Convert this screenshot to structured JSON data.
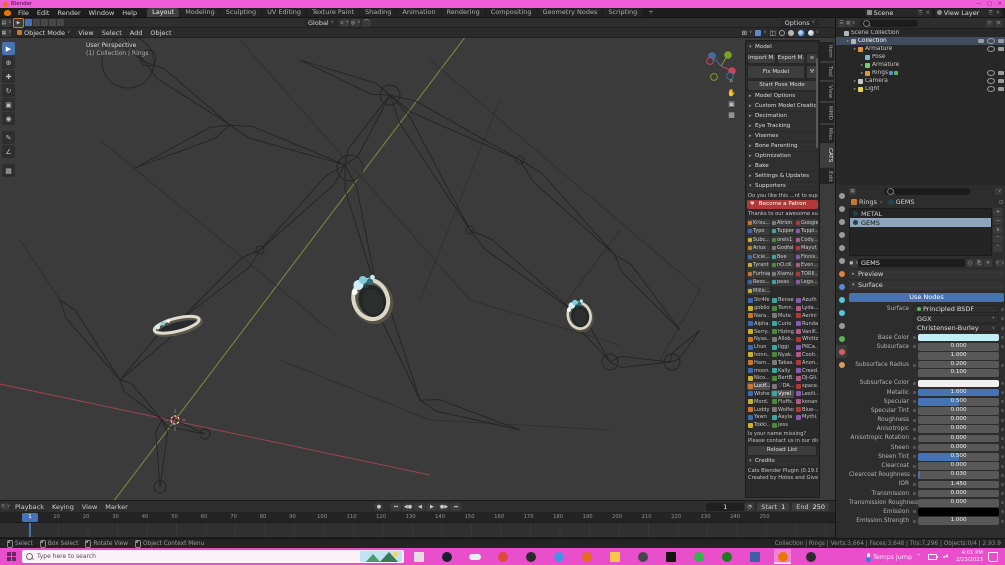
{
  "colors": {
    "accent": "#4772b3",
    "titlebar_pink": "#ef5ed8",
    "taskbar_pink": "#e94ecb",
    "patron_red": "#b03a3a",
    "base_color": "#c3ecf7",
    "subsurface_color": "#f0f0f0",
    "emission_color": "#000000"
  },
  "window": {
    "title": "Blender"
  },
  "topbar": {
    "menus": [
      "File",
      "Edit",
      "Render",
      "Window",
      "Help"
    ],
    "workspaces": [
      "Layout",
      "Modeling",
      "Sculpting",
      "UV Editing",
      "Texture Paint",
      "Shading",
      "Animation",
      "Rendering",
      "Compositing",
      "Geometry Nodes",
      "Scripting"
    ],
    "active_workspace": "Layout",
    "add_workspace": "+",
    "scene_name": "Scene",
    "view_layer_name": "View Layer"
  },
  "tool_row": {
    "orientation": "Global",
    "options": "Options"
  },
  "viewport": {
    "mode": "Object Mode",
    "menus": [
      "View",
      "Select",
      "Add",
      "Object"
    ],
    "overlay_line1": "User Perspective",
    "overlay_line2": "(1) Collection | Rings",
    "tools": [
      "select-box",
      "cursor",
      "move",
      "rotate",
      "scale",
      "transform",
      "annotate",
      "measure",
      "add-cube"
    ]
  },
  "n_panel": {
    "tabs": [
      "Item",
      "Tool",
      "View",
      "MMD",
      "Misc",
      "CATS",
      "Edit"
    ],
    "active_tab": "CATS",
    "model": {
      "title": "Model",
      "import_label": "Import M...",
      "export_label": "Export M...",
      "fix_model": "Fix Model",
      "start_pose": "Start Pose Mode"
    },
    "sections": [
      "Model Options",
      "Custom Model Creation",
      "Decimation",
      "Eye Tracking",
      "Visemes",
      "Bone Parenting",
      "Optimization",
      "Bake",
      "Settings & Updates"
    ],
    "supporters_title": "Supporters",
    "supporters": {
      "question": "Do you like this ...nt to support us?",
      "patron": "Become a Patron",
      "thanks": "Thanks to our awesome supporte...",
      "badges": [
        "Krisu...",
        "Atrion",
        "Googie",
        "Typo",
        "Tupper",
        "Tuppi...",
        "Subc...",
        "orels1",
        "Cody...",
        "Arius",
        "Godfal",
        "Mayuf...",
        "Cicie...",
        "Bee",
        "Finnis...",
        "Tyrant",
        "nO.cK",
        "Even...",
        "Furtnap",
        "Xiamu",
        "TORII...",
        "Reos...",
        "peas",
        "Lego...",
        "Millic..."
      ],
      "names": [
        "Str4fe",
        "Bense...",
        "Azuth",
        "gobliox",
        "Tomn.",
        "Lyda...",
        "Nara...",
        "Mute.",
        "Aerini",
        "Alpha...",
        "Curio",
        "Runda",
        "Serry...",
        "Hizing",
        "Vanill...",
        "Nyas...",
        "Allob...",
        "Whittz",
        "Lhun",
        "Iiggi",
        "PKCa...",
        "honn...",
        "Nyak...",
        "Coolr...",
        "Ham...",
        "Tabas...",
        "Anon...",
        "moon.",
        "Kally",
        "Creed...",
        "Nico...",
        "BertB...",
        "DJ-Gli...",
        "Lucif...",
        "♡DA...",
        "space...",
        "Wishes",
        "Vyrel",
        "Lexiii...",
        "Mord.",
        "Fluffs.",
        "konan",
        "Luddy",
        "Wolfed",
        "Blue-...",
        "Yawn",
        "Aayla",
        "Mythi...",
        "Tokki...",
        "jess"
      ],
      "highlighted": [
        "Lucif...",
        "Vyrel"
      ],
      "missing1": "Is your name missing?",
      "missing2": "Please contact us in our disc...",
      "reload": "Reload List"
    },
    "credits": {
      "title": "Credits",
      "plugin": "Cats Blender Plugin (0.19.0)",
      "created_by": "Created by Hotox and GiveMeAll..."
    }
  },
  "outliner": {
    "rows": [
      {
        "label": "Scene Collection",
        "depth": 0,
        "icon": "scene-collection",
        "caret": false,
        "eye": false,
        "cam": false,
        "selected": false
      },
      {
        "label": "Collection",
        "depth": 1,
        "icon": "collection",
        "caret": true,
        "eye": true,
        "cam": true,
        "selected": true,
        "screen": true
      },
      {
        "label": "Armature",
        "depth": 2,
        "icon": "armature",
        "caret": true,
        "eye": true,
        "cam": true,
        "selected": false
      },
      {
        "label": "Pose",
        "depth": 3,
        "icon": "pose",
        "caret": false,
        "eye": false,
        "cam": false,
        "selected": false
      },
      {
        "label": "Armature",
        "depth": 3,
        "icon": "armature-data",
        "caret": true,
        "eye": false,
        "cam": false,
        "selected": false
      },
      {
        "label": "Rings",
        "depth": 3,
        "icon": "mesh",
        "caret": true,
        "eye": true,
        "cam": true,
        "selected": false,
        "badges": true
      },
      {
        "label": "Camera",
        "depth": 2,
        "icon": "camera",
        "caret": true,
        "eye": true,
        "cam": true,
        "selected": false
      },
      {
        "label": "Light",
        "depth": 2,
        "icon": "light",
        "caret": true,
        "eye": true,
        "cam": true,
        "selected": false
      }
    ]
  },
  "properties": {
    "tabs": [
      "tool",
      "render",
      "output",
      "view-layer",
      "scene",
      "world",
      "object",
      "modifiers",
      "particles",
      "physics",
      "constraints",
      "data",
      "material",
      "texture"
    ],
    "active_tab": "material",
    "breadcrumb_object": "Rings",
    "breadcrumb_material": "GEMS",
    "slots": [
      {
        "name": "METAL",
        "selected": false
      },
      {
        "name": "GEMS",
        "selected": true
      }
    ],
    "name_field": "GEMS",
    "preview_label": "Preview",
    "surface_label": "Surface",
    "use_nodes": "Use Nodes",
    "surface_row_label": "Surface",
    "surface_row_value": "Principled BSDF",
    "distribution": "GGX",
    "subsurface_method": "Christensen-Burley",
    "fields": [
      {
        "label": "Base Color",
        "type": "color",
        "color": "#c3ecf7"
      },
      {
        "label": "Subsurface",
        "type": "slider",
        "value": "0.000",
        "fill": 0
      },
      {
        "label": "Subsurface Radius",
        "type": "multi",
        "values": [
          "1.000",
          "0.200",
          "0.100"
        ]
      },
      {
        "label": "Subsurface Color",
        "type": "color",
        "color": "#f0f0f0"
      },
      {
        "label": "Metallic",
        "type": "slider",
        "value": "1.000",
        "fill": 1
      },
      {
        "label": "Specular",
        "type": "slider",
        "value": "0.500",
        "fill": 0.5
      },
      {
        "label": "Specular Tint",
        "type": "slider",
        "value": "0.000",
        "fill": 0
      },
      {
        "label": "Roughness",
        "type": "slider",
        "value": "0.000",
        "fill": 0
      },
      {
        "label": "Anisotropic",
        "type": "slider",
        "value": "0.000",
        "fill": 0
      },
      {
        "label": "Anisotropic Rotation",
        "type": "slider",
        "value": "0.000",
        "fill": 0
      },
      {
        "label": "Sheen",
        "type": "slider",
        "value": "0.000",
        "fill": 0
      },
      {
        "label": "Sheen Tint",
        "type": "slider",
        "value": "0.500",
        "fill": 0.5
      },
      {
        "label": "Clearcoat",
        "type": "slider",
        "value": "0.000",
        "fill": 0
      },
      {
        "label": "Clearcoat Roughness",
        "type": "slider",
        "value": "0.030",
        "fill": 0.03
      },
      {
        "label": "IOR",
        "type": "value",
        "value": "1.450"
      },
      {
        "label": "Transmission",
        "type": "slider",
        "value": "0.000",
        "fill": 0
      },
      {
        "label": "Transmission Roughness",
        "type": "slider",
        "value": "0.000",
        "fill": 0
      },
      {
        "label": "Emission",
        "type": "color",
        "color": "#000000"
      },
      {
        "label": "Emission Strength",
        "type": "slider",
        "value": "1.000",
        "fill": 0
      }
    ]
  },
  "timeline": {
    "menus": [
      "Playback",
      "Keying",
      "View",
      "Marker"
    ],
    "ruler_numbers": [
      10,
      20,
      30,
      40,
      50,
      60,
      70,
      80,
      90,
      100,
      110,
      120,
      130,
      140,
      150,
      160,
      170,
      180,
      190,
      200,
      210,
      220,
      230,
      240,
      250
    ],
    "current_frame": "1",
    "start_label": "Start",
    "start_value": "1",
    "end_label": "End",
    "end_value": "250"
  },
  "status_bar": {
    "hints": [
      {
        "icon": "mouse-left",
        "label": "Select"
      },
      {
        "icon": "mouse-left-drag",
        "label": "Box Select"
      },
      {
        "icon": "mouse-middle",
        "label": "Rotate View"
      },
      {
        "icon": "mouse-right",
        "label": "Object Context Menu"
      }
    ],
    "stats": "Collection | Rings | Verts:3,664 | Faces:3,648 | Tris:7,296 | Objects:0/4 | 2.93.9"
  },
  "taskbar": {
    "search_placeholder": "Type here to search",
    "icons": [
      {
        "name": "task-view",
        "color": "#e9dce6",
        "shape": "square"
      },
      {
        "name": "steam",
        "color": "#17202e",
        "shape": "round"
      },
      {
        "name": "game-capsule",
        "color": "#ececec",
        "shape": "pill"
      },
      {
        "name": "chrome",
        "color": "#de4b3b",
        "shape": "round"
      },
      {
        "name": "epic-games",
        "color": "#2a2a2a",
        "shape": "round"
      },
      {
        "name": "chrome-profile",
        "color": "#4a90e2",
        "shape": "round"
      },
      {
        "name": "firefox",
        "color": "#e66a1f",
        "shape": "round"
      },
      {
        "name": "file-explorer",
        "color": "#f7c64a",
        "shape": "square"
      },
      {
        "name": "gog-galaxy",
        "color": "#45454d",
        "shape": "round"
      },
      {
        "name": "code-editor",
        "color": "#141414",
        "shape": "square"
      },
      {
        "name": "geforce",
        "color": "#35b54a",
        "shape": "round"
      },
      {
        "name": "xbox",
        "color": "#1e7a1e",
        "shape": "round"
      },
      {
        "name": "vrchat",
        "color": "#3e5fa8",
        "shape": "square"
      },
      {
        "name": "blender",
        "color": "#ea7600",
        "shape": "round",
        "active": true
      },
      {
        "name": "obs-studio",
        "color": "#2d2b2e",
        "shape": "round"
      }
    ],
    "tray": {
      "weather": "Temps jump",
      "time": "4:01 PM",
      "date": "2/23/2023"
    }
  }
}
